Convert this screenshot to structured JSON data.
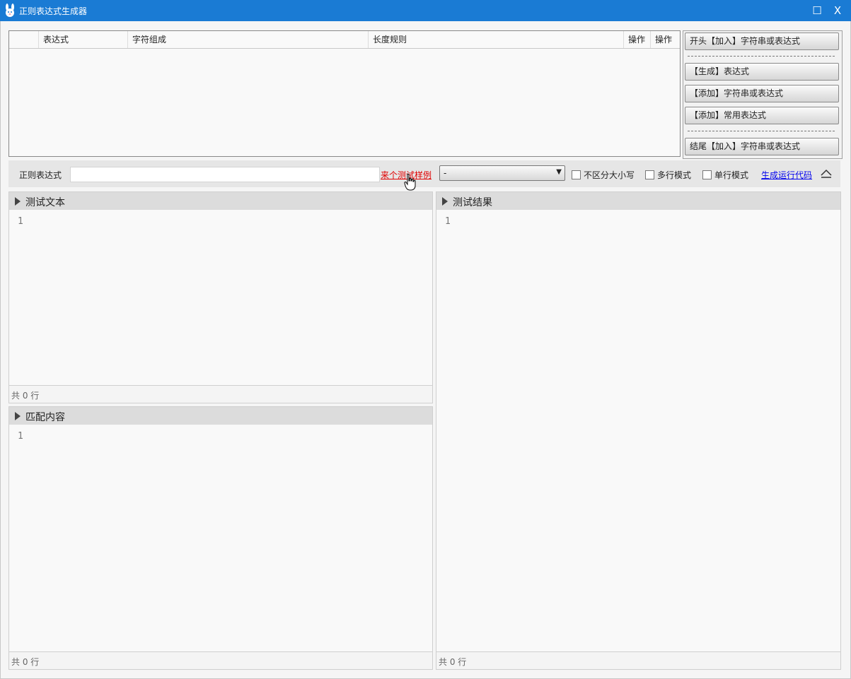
{
  "window": {
    "title": "正则表达式生成器",
    "maximize_glyph": "☐",
    "close_glyph": "X"
  },
  "grid": {
    "columns": [
      "",
      "表达式",
      "字符组成",
      "长度规则",
      "操作",
      "操作"
    ]
  },
  "side_buttons": {
    "start_add": "开头【加入】字符串或表达式",
    "generate": "【生成】表达式",
    "add_string": "【添加】字符串或表达式",
    "add_common": "【添加】常用表达式",
    "end_add": "结尾【加入】字符串或表达式"
  },
  "regex_bar": {
    "label": "正则表达式",
    "input_value": "",
    "sample_link": "来个测试样例",
    "dropdown_value": "-",
    "options": {
      "ignore_case": "不区分大小写",
      "multiline": "多行模式",
      "singleline": "单行模式"
    },
    "generate_code_link": "生成运行代码"
  },
  "panels": {
    "test_text": {
      "title": "测试文本",
      "line_number": "1",
      "footer": "共 0 行"
    },
    "match_content": {
      "title": "匹配内容",
      "line_number": "1",
      "footer": "共 0 行"
    },
    "test_result": {
      "title": "测试结果",
      "line_number": "1",
      "footer": "共 0 行"
    }
  },
  "colors": {
    "titlebar": "#1a7bd4",
    "sample_link": "#e00000",
    "code_link": "#0000ee"
  }
}
